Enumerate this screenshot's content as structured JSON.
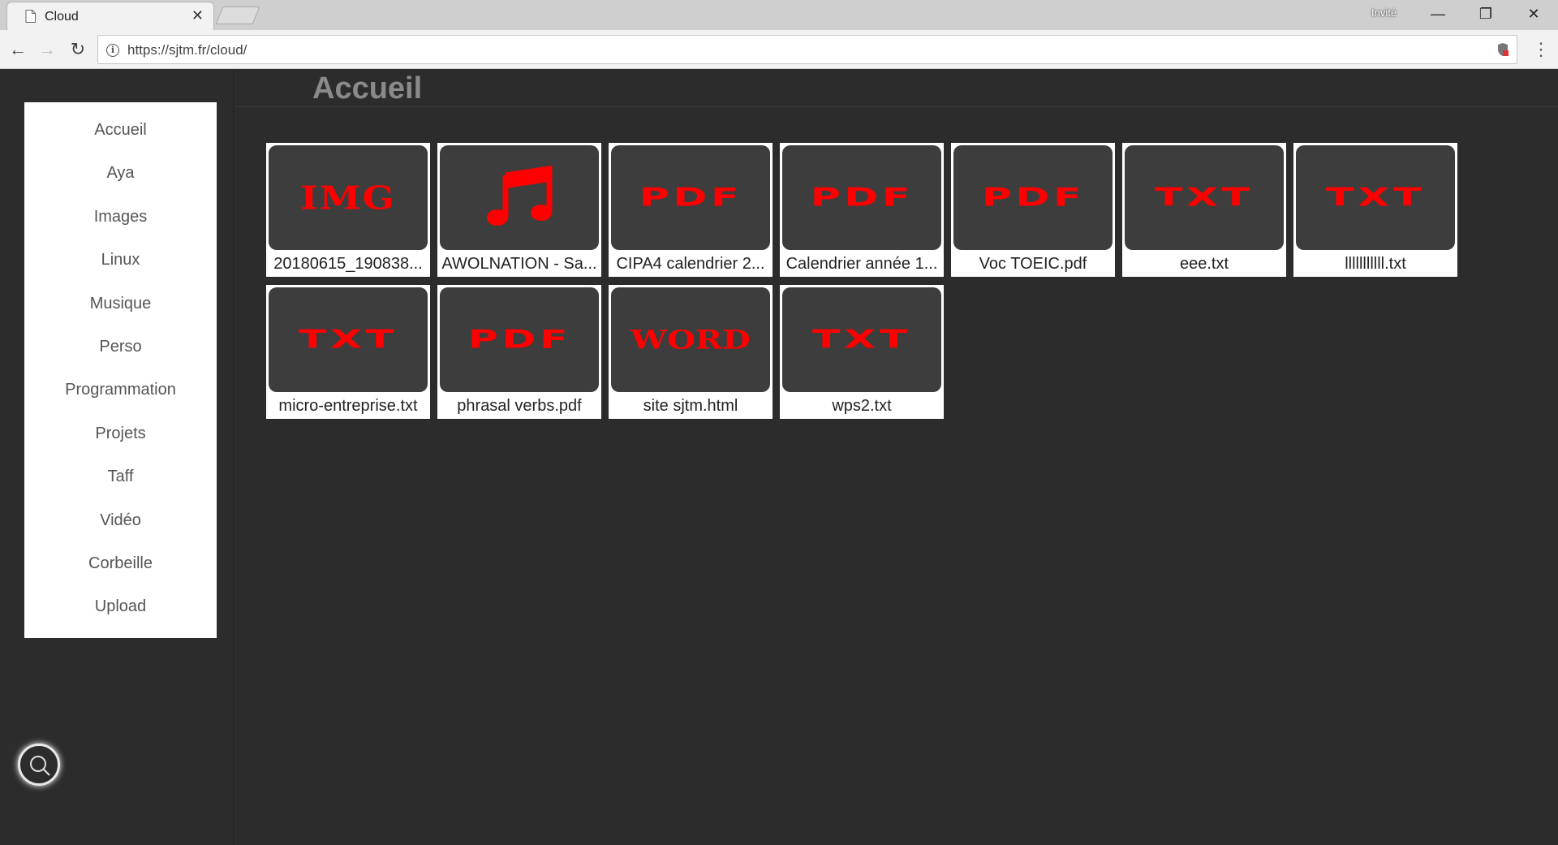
{
  "browser": {
    "tab_title": "Cloud",
    "tab_close": "✕",
    "guest_label": "Invité",
    "url": "https://sjtm.fr/cloud/",
    "window_controls": {
      "minimize": "—",
      "restore": "❐",
      "close": "✕"
    },
    "nav": {
      "back": "←",
      "forward": "→",
      "reload": "↻",
      "menu": "⋮"
    }
  },
  "page": {
    "title": "Accueil"
  },
  "sidebar": {
    "items": [
      {
        "label": "Accueil"
      },
      {
        "label": "Aya"
      },
      {
        "label": "Images"
      },
      {
        "label": "Linux"
      },
      {
        "label": "Musique"
      },
      {
        "label": "Perso"
      },
      {
        "label": "Programmation"
      },
      {
        "label": "Projets"
      },
      {
        "label": "Taff"
      },
      {
        "label": "Vidéo"
      },
      {
        "label": "Corbeille"
      },
      {
        "label": "Upload"
      }
    ],
    "search_icon": "search-icon"
  },
  "files": [
    {
      "name": "20180615_190838...",
      "badge": "IMG",
      "icon": "image-file-icon"
    },
    {
      "name": "AWOLNATION - Sa...",
      "badge": "♫",
      "icon": "music-file-icon"
    },
    {
      "name": "CIPA4 calendrier 2...",
      "badge": "PDF",
      "icon": "pdf-file-icon"
    },
    {
      "name": "Calendrier année 1...",
      "badge": "PDF",
      "icon": "pdf-file-icon"
    },
    {
      "name": "Voc TOEIC.pdf",
      "badge": "PDF",
      "icon": "pdf-file-icon"
    },
    {
      "name": "eee.txt",
      "badge": "TXT",
      "icon": "txt-file-icon"
    },
    {
      "name": "lllllllllll.txt",
      "badge": "TXT",
      "icon": "txt-file-icon"
    },
    {
      "name": "micro-entreprise.txt",
      "badge": "TXT",
      "icon": "txt-file-icon"
    },
    {
      "name": "phrasal verbs.pdf",
      "badge": "PDF",
      "icon": "pdf-file-icon"
    },
    {
      "name": "site sjtm.html",
      "badge": "WORD",
      "icon": "word-file-icon"
    },
    {
      "name": "wps2.txt",
      "badge": "TXT",
      "icon": "txt-file-icon"
    }
  ],
  "colors": {
    "badge": "#ff0000",
    "background": "#2c2c2c",
    "thumb": "#3d3d3d"
  }
}
